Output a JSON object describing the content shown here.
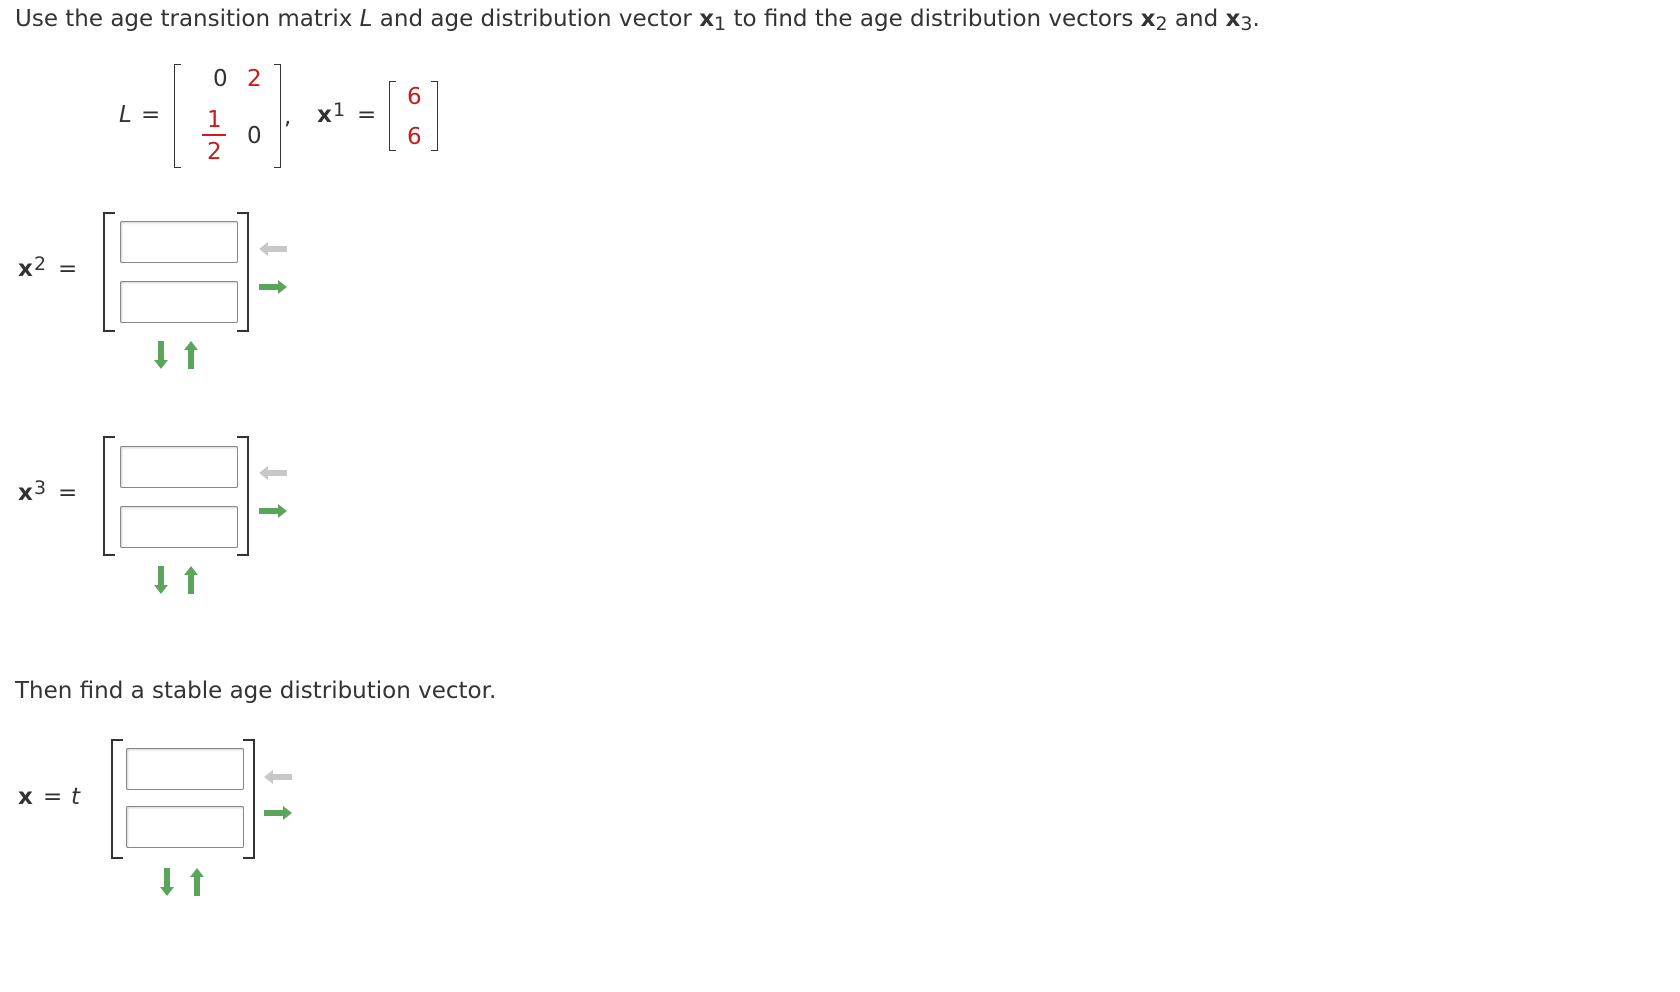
{
  "question": {
    "prefix": "Use the age transition matrix ",
    "L_symbol": "L",
    "mid1": " and age distribution vector ",
    "x": "x",
    "s1": "1",
    "mid2": " to find the age distribution vectors ",
    "s2": "2",
    "and": " and ",
    "s3": "3",
    "period": "."
  },
  "given": {
    "L_label": "L",
    "eq": "=",
    "matrix": {
      "r1c1": "0",
      "r1c2": "2",
      "r2c1_num": "1",
      "r2c1_den": "2",
      "r2c2": "0"
    },
    "comma": ",",
    "x1_label": "x",
    "x1_sub": "1",
    "x1_vector": [
      "6",
      "6"
    ]
  },
  "answers": {
    "x2": {
      "label": "x",
      "sub": "2",
      "eq": "=",
      "values": [
        "",
        ""
      ]
    },
    "x3": {
      "label": "x",
      "sub": "3",
      "eq": "=",
      "values": [
        "",
        ""
      ]
    },
    "stable": {
      "label": "x",
      "eq": "=",
      "t": "t",
      "values": [
        "",
        ""
      ]
    }
  },
  "then_text": "Then find a stable age distribution vector.",
  "icons": {
    "col_remove": "arrow-left-icon",
    "col_add": "arrow-right-icon",
    "row_add": "arrow-down-icon",
    "row_remove": "arrow-up-icon"
  },
  "colors": {
    "text": "#333333",
    "given_values": "#cc1a1a",
    "arrow_active": "#5aa55a",
    "arrow_inactive": "#c8c8c8"
  }
}
